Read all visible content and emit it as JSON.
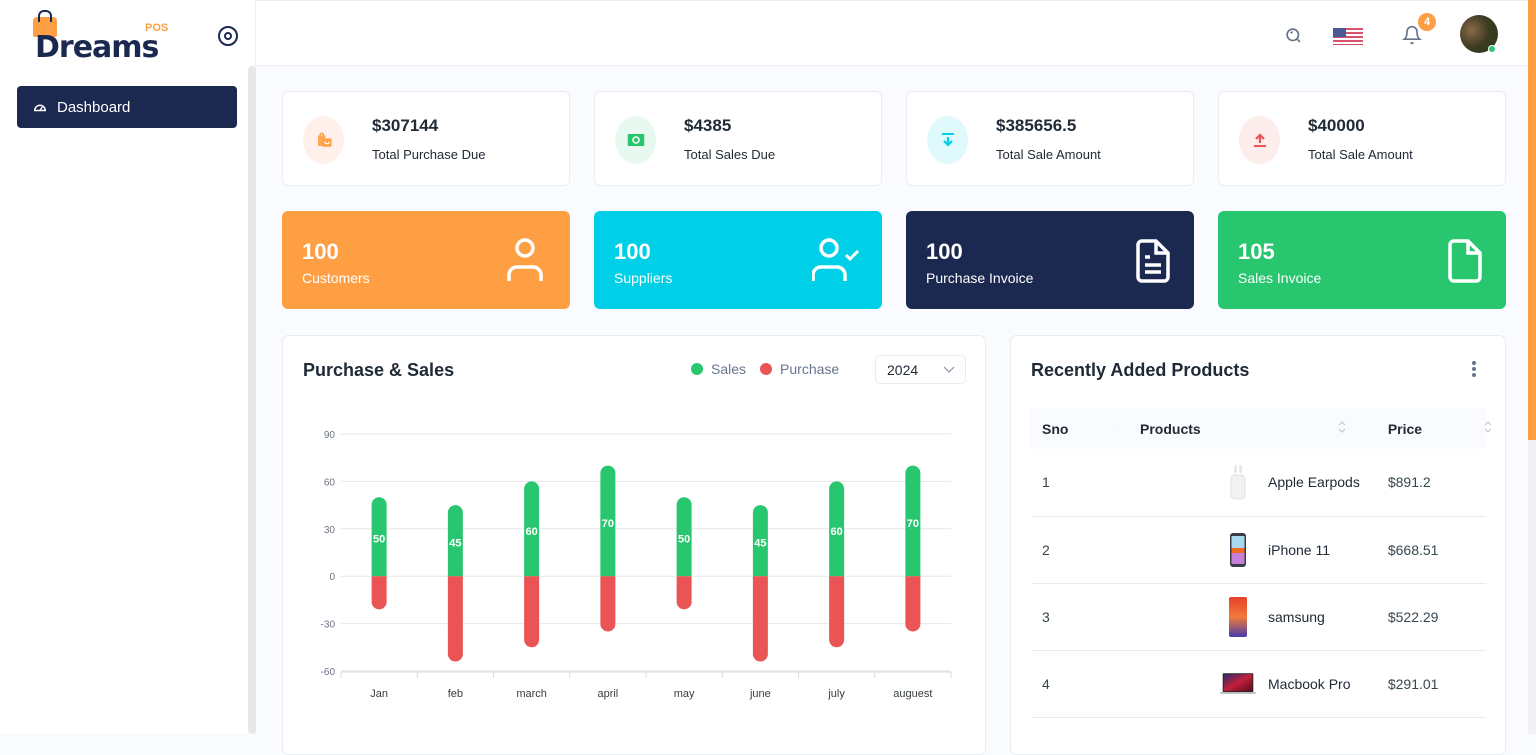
{
  "app": {
    "brand": "Dreams",
    "brand_suffix": "POS"
  },
  "sidebar": {
    "items": [
      {
        "label": "Dashboard",
        "icon": "dashboard-gauge-icon",
        "active": true
      }
    ]
  },
  "topbar": {
    "search_icon": "search-icon",
    "language_flag": "us-flag-icon",
    "notifications_count": "4",
    "user_status": "online"
  },
  "stats": [
    {
      "value": "$307144",
      "label": "Total Purchase Due",
      "icon": "shopping-bag-icon",
      "color": "#ff9f43",
      "bg": "#fff0ec"
    },
    {
      "value": "$4385",
      "label": "Total Sales Due",
      "icon": "cash-icon",
      "color": "#28c76f",
      "bg": "#e8f9ef"
    },
    {
      "value": "$385656.5",
      "label": "Total Sale Amount",
      "icon": "download-arrow-icon",
      "color": "#00cfe8",
      "bg": "#e0f9fc"
    },
    {
      "value": "$40000",
      "label": "Total Sale Amount",
      "icon": "upload-arrow-icon",
      "color": "#ea5455",
      "bg": "#fcecec"
    }
  ],
  "counts": [
    {
      "value": "100",
      "label": "Customers",
      "icon": "user-icon",
      "color": "#ff9f43"
    },
    {
      "value": "100",
      "label": "Suppliers",
      "icon": "user-check-icon",
      "color": "#00cfe8"
    },
    {
      "value": "100",
      "label": "Purchase Invoice",
      "icon": "file-text-icon",
      "color": "#1b2850"
    },
    {
      "value": "105",
      "label": "Sales Invoice",
      "icon": "file-icon",
      "color": "#28c76f"
    }
  ],
  "purchase_sales": {
    "title": "Purchase & Sales",
    "legend": [
      {
        "name": "Sales",
        "color": "#28c76f"
      },
      {
        "name": "Purchase",
        "color": "#ea5455"
      }
    ],
    "year": "2024"
  },
  "chart_data": {
    "type": "bar",
    "stacked": true,
    "title": "Purchase & Sales",
    "categories": [
      "Jan",
      "feb",
      "march",
      "april",
      "may",
      "june",
      "july",
      "auguest"
    ],
    "series": [
      {
        "name": "Sales",
        "color": "#28c76f",
        "values": [
          50,
          45,
          60,
          70,
          50,
          45,
          60,
          70
        ]
      },
      {
        "name": "Purchase",
        "color": "#ea5455",
        "values": [
          -21,
          -54,
          -45,
          -35,
          -21,
          -54,
          -45,
          -35
        ]
      }
    ],
    "yticks": [
      90,
      60,
      30,
      0,
      -30,
      -60
    ],
    "ylim": [
      -60,
      90
    ],
    "grid": true,
    "data_labels_series": "Sales",
    "legend_position": "top-right",
    "xlabel": "",
    "ylabel": ""
  },
  "recent_products": {
    "title": "Recently Added Products",
    "columns": [
      "Sno",
      "Products",
      "Price"
    ],
    "rows": [
      {
        "sno": "1",
        "product": "Apple Earpods",
        "price": "$891.2",
        "image": "earpods-image"
      },
      {
        "sno": "2",
        "product": "iPhone 11",
        "price": "$668.51",
        "image": "iphone-image"
      },
      {
        "sno": "3",
        "product": "samsung",
        "price": "$522.29",
        "image": "samsung-phone-image"
      },
      {
        "sno": "4",
        "product": "Macbook Pro",
        "price": "$291.01",
        "image": "macbook-image"
      }
    ]
  }
}
